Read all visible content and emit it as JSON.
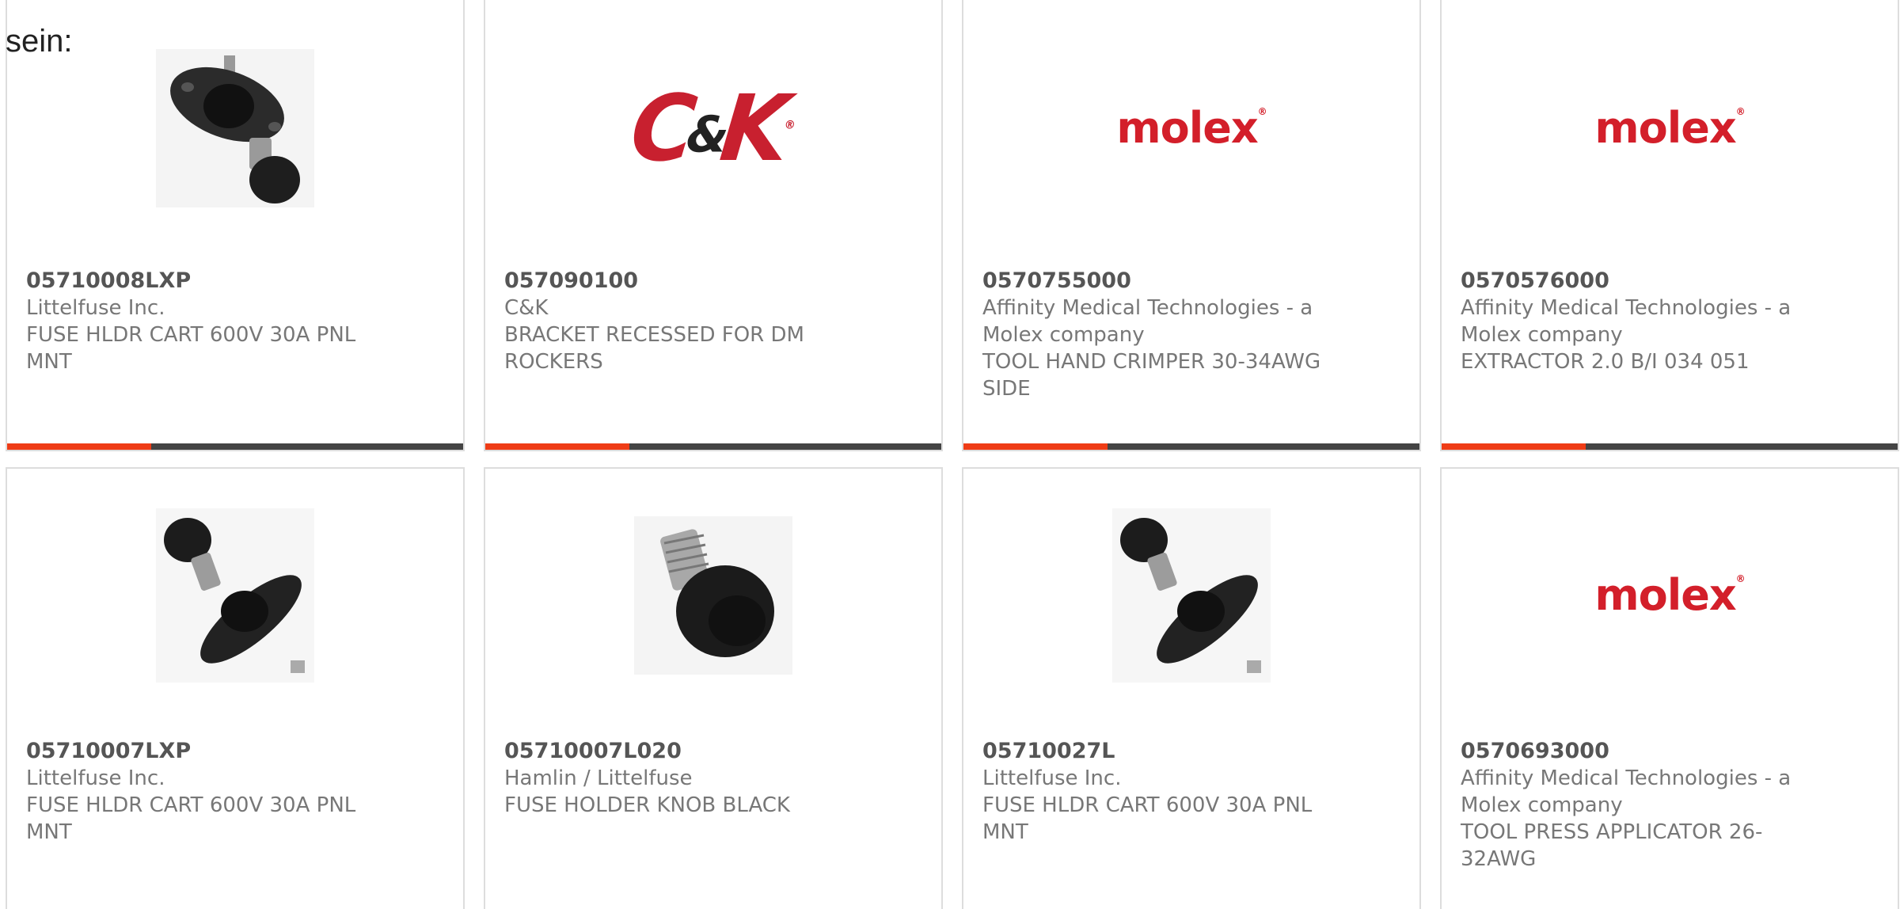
{
  "intro_text": "sein:",
  "colors": {
    "accent": "#ef3c16",
    "bar": "#444444",
    "brand_red": "#c8202f",
    "molex_red": "#d31f2a"
  },
  "products": [
    {
      "part_number": "05710008LXP",
      "manufacturer": "Littelfuse Inc.",
      "description": "FUSE HLDR CART 600V 30A PNL MNT",
      "image": "fuse-holder-panel-photo"
    },
    {
      "part_number": "057090100",
      "manufacturer": "C&K",
      "description": "BRACKET RECESSED FOR DM ROCKERS",
      "image": "ck-logo",
      "logo_text": "C&K"
    },
    {
      "part_number": "0570755000",
      "manufacturer": "Affinity Medical Technologies - a Molex company",
      "description": "TOOL HAND CRIMPER 30-34AWG SIDE",
      "image": "molex-logo",
      "logo_text": "molex"
    },
    {
      "part_number": "0570576000",
      "manufacturer": "Affinity Medical Technologies - a Molex company",
      "description": "EXTRACTOR 2.0 B/I 034 051",
      "image": "molex-logo",
      "logo_text": "molex"
    },
    {
      "part_number": "05710007LXP",
      "manufacturer": "Littelfuse Inc.",
      "description": "FUSE HLDR CART 600V 30A PNL MNT",
      "image": "fuse-holder-knob-photo"
    },
    {
      "part_number": "05710007L020",
      "manufacturer": "Hamlin / Littelfuse",
      "description": "FUSE HOLDER KNOB BLACK",
      "image": "fuse-knob-photo"
    },
    {
      "part_number": "05710027L",
      "manufacturer": "Littelfuse Inc.",
      "description": "FUSE HLDR CART 600V 30A PNL MNT",
      "image": "fuse-holder-knob-photo"
    },
    {
      "part_number": "0570693000",
      "manufacturer": "Affinity Medical Technologies - a Molex company",
      "description": "TOOL PRESS APPLICATOR 26-32AWG",
      "image": "molex-logo",
      "logo_text": "molex"
    }
  ]
}
